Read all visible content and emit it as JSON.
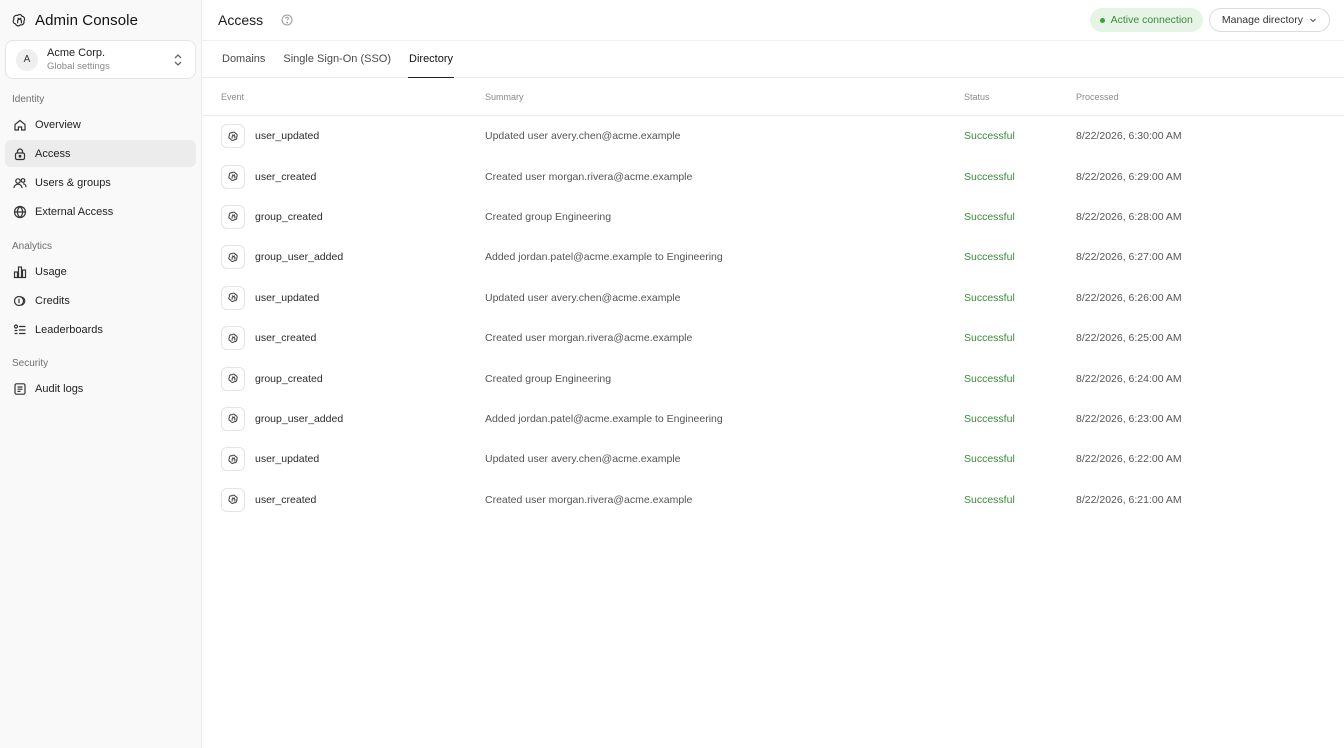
{
  "app": {
    "title": "Admin Console"
  },
  "org": {
    "avatar_letter": "A",
    "name": "Acme Corp.",
    "subtitle": "Global settings"
  },
  "sidebar": {
    "sections": [
      {
        "label": "Identity",
        "items": [
          {
            "label": "Overview",
            "icon": "home-icon",
            "active": false
          },
          {
            "label": "Access",
            "icon": "lock-icon",
            "active": true
          },
          {
            "label": "Users & groups",
            "icon": "users-icon",
            "active": false
          },
          {
            "label": "External Access",
            "icon": "globe-icon",
            "active": false
          }
        ]
      },
      {
        "label": "Analytics",
        "items": [
          {
            "label": "Usage",
            "icon": "bar-chart-icon",
            "active": false
          },
          {
            "label": "Credits",
            "icon": "coins-icon",
            "active": false
          },
          {
            "label": "Leaderboards",
            "icon": "leaderboard-icon",
            "active": false
          }
        ]
      },
      {
        "label": "Security",
        "items": [
          {
            "label": "Audit logs",
            "icon": "audit-log-icon",
            "active": false
          }
        ]
      }
    ]
  },
  "header": {
    "title": "Access",
    "status_badge": "Active connection",
    "manage_button": "Manage directory"
  },
  "tabs": [
    {
      "label": "Domains",
      "active": false
    },
    {
      "label": "Single Sign-On (SSO)",
      "active": false
    },
    {
      "label": "Directory",
      "active": true
    }
  ],
  "table": {
    "columns": {
      "event": "Event",
      "summary": "Summary",
      "status": "Status",
      "processed": "Processed"
    },
    "rows": [
      {
        "event": "user_updated",
        "summary": "Updated user avery.chen@acme.example",
        "status": "Successful",
        "processed": "8/22/2026, 6:30:00 AM"
      },
      {
        "event": "user_created",
        "summary": "Created user morgan.rivera@acme.example",
        "status": "Successful",
        "processed": "8/22/2026, 6:29:00 AM"
      },
      {
        "event": "group_created",
        "summary": "Created group Engineering",
        "status": "Successful",
        "processed": "8/22/2026, 6:28:00 AM"
      },
      {
        "event": "group_user_added",
        "summary": "Added jordan.patel@acme.example to Engineering",
        "status": "Successful",
        "processed": "8/22/2026, 6:27:00 AM"
      },
      {
        "event": "user_updated",
        "summary": "Updated user avery.chen@acme.example",
        "status": "Successful",
        "processed": "8/22/2026, 6:26:00 AM"
      },
      {
        "event": "user_created",
        "summary": "Created user morgan.rivera@acme.example",
        "status": "Successful",
        "processed": "8/22/2026, 6:25:00 AM"
      },
      {
        "event": "group_created",
        "summary": "Created group Engineering",
        "status": "Successful",
        "processed": "8/22/2026, 6:24:00 AM"
      },
      {
        "event": "group_user_added",
        "summary": "Added jordan.patel@acme.example to Engineering",
        "status": "Successful",
        "processed": "8/22/2026, 6:23:00 AM"
      },
      {
        "event": "user_updated",
        "summary": "Updated user avery.chen@acme.example",
        "status": "Successful",
        "processed": "8/22/2026, 6:22:00 AM"
      },
      {
        "event": "user_created",
        "summary": "Created user morgan.rivera@acme.example",
        "status": "Successful",
        "processed": "8/22/2026, 6:21:00 AM"
      }
    ]
  },
  "colors": {
    "success": "#3a8a3a",
    "active_badge_bg": "#e6f4e6",
    "sidebar_bg": "#f9f9f9",
    "active_nav_bg": "#ececec"
  }
}
